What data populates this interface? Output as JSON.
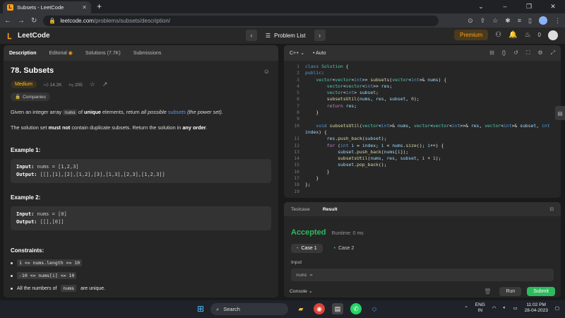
{
  "browser": {
    "tab_title": "Subsets - LeetCode",
    "url_host": "leetcode.com",
    "url_path": "/problems/subsets/description/"
  },
  "lcnav": {
    "logo_text": "LeetCode",
    "problem_list": "Problem List",
    "premium": "Premium",
    "streak": "0"
  },
  "left": {
    "tabs": [
      "Description",
      "Editorial",
      "Solutions (7.7K)",
      "Submissions"
    ],
    "title": "78. Subsets",
    "difficulty": "Medium",
    "likes": "14.2K",
    "dislikes": "205",
    "companies": "Companies",
    "desc_1": "Given an integer array",
    "desc_nums": "nums",
    "desc_2": "of",
    "desc_unique": "unique",
    "desc_3": "elements, return",
    "desc_all": "all possible",
    "desc_subsets": "subsets",
    "desc_4": "(the power set).",
    "desc2_1": "The solution set",
    "desc2_mustnot": "must not",
    "desc2_2": "contain duplicate subsets. Return the solution in",
    "desc2_any": "any order",
    "desc2_3": ".",
    "ex1_title": "Example 1:",
    "ex1_input_label": "Input:",
    "ex1_input": "nums = [1,2,3]",
    "ex1_output_label": "Output:",
    "ex1_output": "[[],[1],[2],[1,2],[3],[1,3],[2,3],[1,2,3]]",
    "ex2_title": "Example 2:",
    "ex2_input_label": "Input:",
    "ex2_input": "nums = [0]",
    "ex2_output_label": "Output:",
    "ex2_output": "[[],[0]]",
    "constraints_title": "Constraints:",
    "constraints": [
      "1 <= nums.length <= 10",
      "-10 <= nums[i] <= 10"
    ],
    "constraint3_a": "All the numbers of",
    "constraint3_b": "nums",
    "constraint3_c": "are unique."
  },
  "editor": {
    "language": "C++",
    "mode": "Auto"
  },
  "result": {
    "tabs": [
      "Testcase",
      "Result"
    ],
    "status": "Accepted",
    "runtime": "Runtime: 0 ms",
    "case1": "Case 1",
    "case2": "Case 2",
    "input_label": "Input",
    "input_value": "nums ="
  },
  "bottombar": {
    "console": "Console",
    "run": "Run",
    "submit": "Submit"
  },
  "taskbar": {
    "search": "Search",
    "lang1": "ENG",
    "lang2": "IN",
    "time": "11:02 PM",
    "date": "28-04-2023"
  },
  "colors": {
    "accent": "#ffa116",
    "accepted": "#2cbb5d",
    "medium": "#ffc01e"
  }
}
